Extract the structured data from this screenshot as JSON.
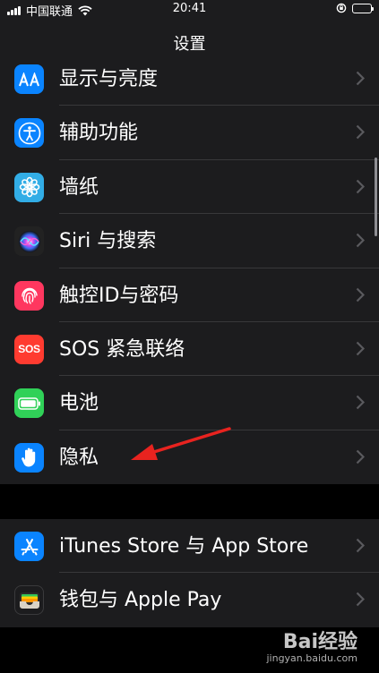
{
  "status_bar": {
    "carrier": "中国联通",
    "time": "20:41",
    "battery_level": 0.0
  },
  "nav": {
    "title": "设置"
  },
  "group1": [
    {
      "key": "display",
      "label": "显示与亮度",
      "icon": "display-aa-icon",
      "color": "#0a84ff"
    },
    {
      "key": "accessibility",
      "label": "辅助功能",
      "icon": "accessibility-icon",
      "color": "#0a84ff"
    },
    {
      "key": "wallpaper",
      "label": "墙纸",
      "icon": "wallpaper-flower-icon",
      "color": "#32ade6"
    },
    {
      "key": "siri",
      "label": "Siri 与搜索",
      "icon": "siri-icon",
      "color": "#222222"
    },
    {
      "key": "touchid",
      "label": "触控ID与密码",
      "icon": "fingerprint-icon",
      "color": "#ff375f"
    },
    {
      "key": "sos",
      "label": "SOS 紧急联络",
      "icon": "sos-icon",
      "color": "#ff3b30",
      "icon_text": "SOS"
    },
    {
      "key": "battery",
      "label": "电池",
      "icon": "battery-icon",
      "color": "#30d158"
    },
    {
      "key": "privacy",
      "label": "隐私",
      "icon": "privacy-hand-icon",
      "color": "#0a84ff"
    }
  ],
  "group2": [
    {
      "key": "itunes",
      "label": "iTunes Store 与 App Store",
      "icon": "app-store-icon",
      "color": "#0a84ff"
    },
    {
      "key": "wallet",
      "label": "钱包与 Apple Pay",
      "icon": "wallet-icon",
      "color": "#1c1c1e"
    }
  ],
  "watermark": {
    "brand": "Bai经验",
    "sub": "jingyan.baidu.com"
  },
  "colors": {
    "background": "#000000",
    "cell": "#1c1c1e",
    "separator": "#38383a",
    "chevron": "#5a5a5e",
    "annotation_arrow": "#e8231f"
  }
}
